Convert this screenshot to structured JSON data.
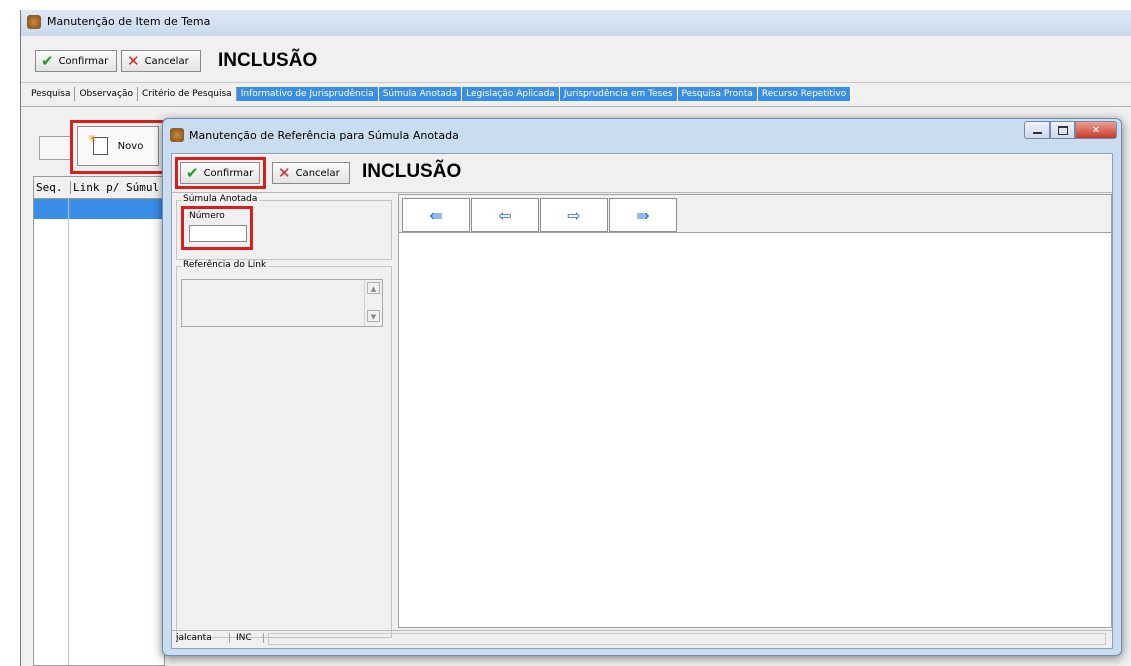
{
  "outer": {
    "title": "Manutenção de Item de Tema",
    "confirm_label": "Confirmar",
    "cancel_label": "Cancelar",
    "mode": "INCLUSÃO",
    "tabs": [
      {
        "label": "Pesquisa",
        "selected": false
      },
      {
        "label": "Observação",
        "selected": false
      },
      {
        "label": "Critério de Pesquisa",
        "selected": false
      },
      {
        "label": "Informativo de Jurisprudência",
        "selected": true
      },
      {
        "label": "Súmula Anotada",
        "selected": true
      },
      {
        "label": "Legislação Aplicada",
        "selected": true
      },
      {
        "label": "Jurisprudência em Teses",
        "selected": true
      },
      {
        "label": "Pesquisa Pronta",
        "selected": true
      },
      {
        "label": "Recurso Repetitivo",
        "selected": true
      }
    ],
    "new_label": "Novo",
    "grid_headers": [
      "Seq.",
      "Link p/ Súmul"
    ]
  },
  "dialog": {
    "title": "Manutenção de Referência para Súmula Anotada",
    "confirm_label": "Confirmar",
    "cancel_label": "Cancelar",
    "mode": "INCLUSÃO",
    "group_sumula": "Súmula Anotada",
    "numero_label": "Número",
    "numero_value": "",
    "group_referencia": "Referência do Link",
    "nav": [
      "⇚",
      "⇦",
      "⇨",
      "⇛"
    ],
    "status_user": "jalcanta",
    "status_mode": "INC"
  },
  "colors": {
    "accent": "#3a8ee6",
    "highlight": "#d62020",
    "window_bg": "#f0f0f0"
  }
}
